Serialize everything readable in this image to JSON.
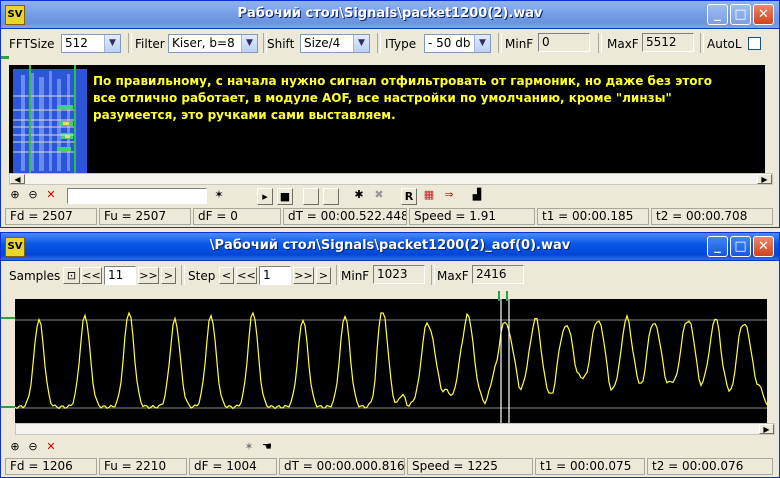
{
  "window1": {
    "title": "Рабочий стол\\Signals\\packet1200(2).wav",
    "app_icon_text": "SV",
    "fft_label": "FFTSize",
    "fft_value": "512",
    "filter_label": "Filter",
    "filter_value": "Kiser, b=8",
    "shift_label": "Shift",
    "shift_value": "Size/4",
    "itype_label": "IType",
    "itype_value": "- 50 db",
    "minf_label": "MinF",
    "minf_value": "0",
    "maxf_label": "MaxF",
    "maxf_value": "5512",
    "autol_label": "AutoL",
    "message": "По правильному, с начала нужно сигнал отфильтровать от гармоник, но даже без этого\nвсе отлично работает, в модуле AOF, все настройки по умолчанию, кроме \"линзы\"\nразумеется, это ручками сами выставляем.",
    "status": {
      "fd": "Fd = 2507",
      "fu": "Fu = 2507",
      "df": "dF = 0",
      "dt": "dT = 00:00.522.448",
      "speed": "Speed = 1.91",
      "t1": "t1 = 00:00.185",
      "t2": "t2 = 00:00.708"
    },
    "colors": {
      "message": "#ffff2e",
      "spectrum_bg": "#2c55d8"
    }
  },
  "window2": {
    "title": "\\Рабочий стол\\Signals\\packet1200(2)_aof(0).wav",
    "app_icon_text": "SV",
    "samples_label": "Samples",
    "samples_value": "11",
    "step_label": "Step",
    "step_value": "1",
    "minf_label": "MinF",
    "minf_value": "1023",
    "maxf_label": "MaxF",
    "maxf_value": "2416",
    "nav": {
      "first": "<<",
      "prev": "<",
      "next": ">>",
      "last": ">"
    },
    "status": {
      "fd": "Fd = 1206",
      "fu": "Fu = 2210",
      "df": "dF = 1004",
      "dt": "dT = 00:00.000.816",
      "speed": "Speed = 1225",
      "t1": "t1 = 00:00.075",
      "t2": "t2 = 00:00.076"
    },
    "colors": {
      "waveform": "#ffff40",
      "markers": "#ffffff",
      "baseline": "#7b7b7b"
    }
  },
  "icons": [
    "zoom-in-icon",
    "zoom-out-icon",
    "reset-zoom-icon",
    "play-icon",
    "stop-icon",
    "record-icon",
    "export-icon",
    "chart-icon",
    "cursor-icon",
    "hand-icon"
  ]
}
